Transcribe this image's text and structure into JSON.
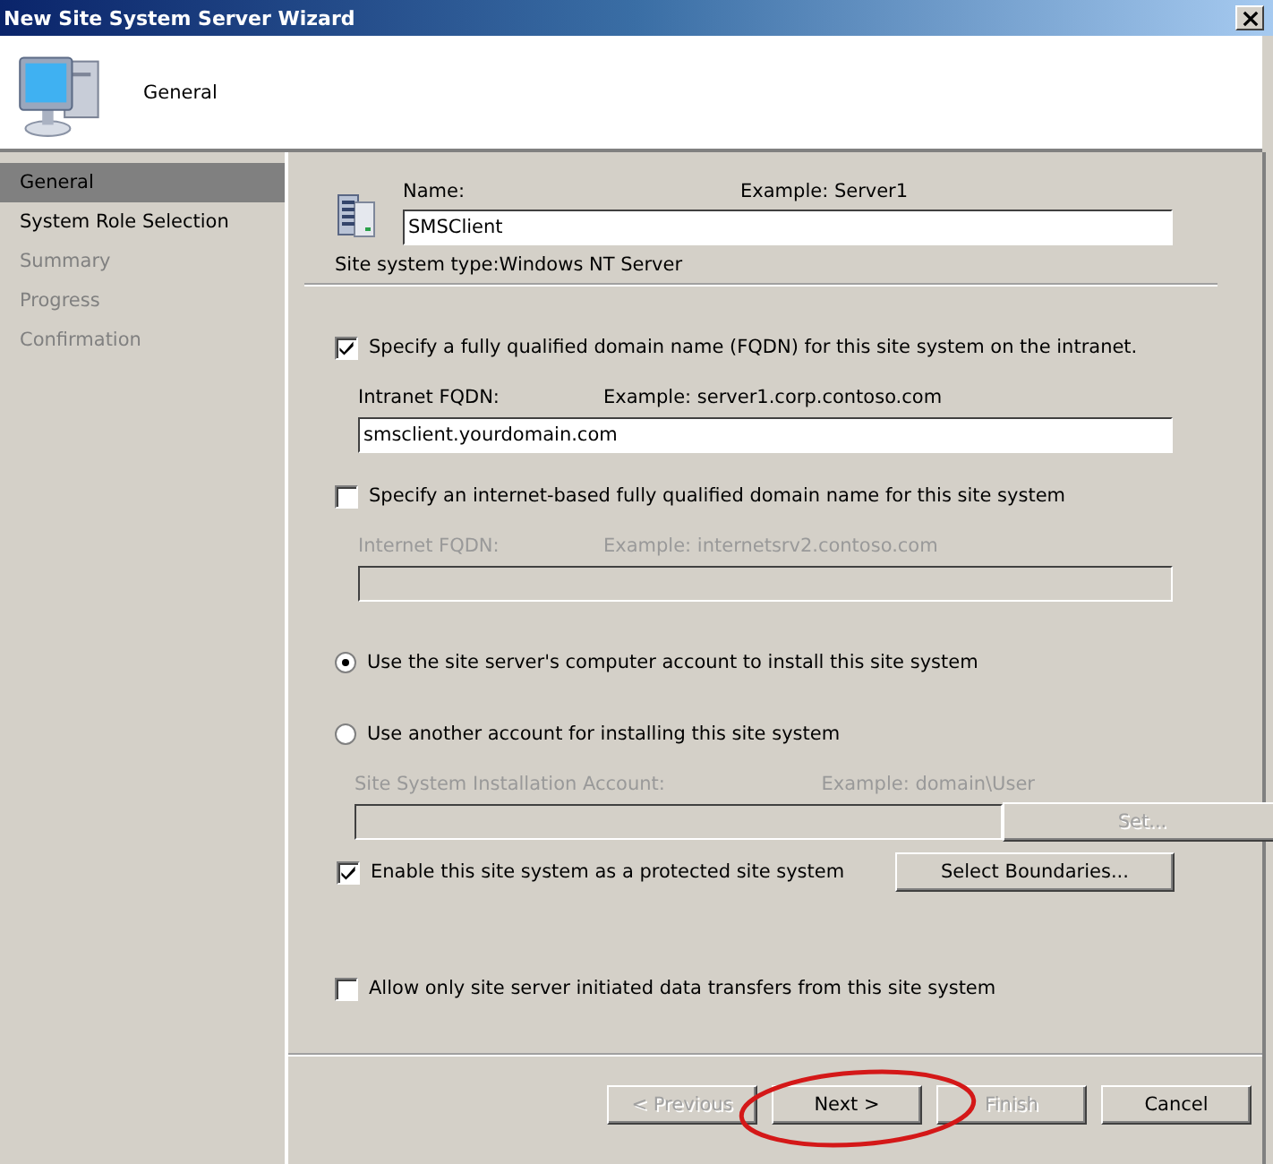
{
  "window": {
    "title": "New Site System Server Wizard"
  },
  "header": {
    "title": "General"
  },
  "sidebar": {
    "items": [
      {
        "label": "General",
        "selected": true,
        "disabled": false
      },
      {
        "label": "System Role Selection",
        "selected": false,
        "disabled": false
      },
      {
        "label": "Summary",
        "selected": false,
        "disabled": true
      },
      {
        "label": "Progress",
        "selected": false,
        "disabled": true
      },
      {
        "label": "Confirmation",
        "selected": false,
        "disabled": true
      }
    ]
  },
  "form": {
    "name": {
      "label": "Name:",
      "example": "Example: Server1",
      "value": "SMSClient"
    },
    "site_system_type": "Site system type:Windows NT Server",
    "fqdn_checkbox": {
      "label": "Specify a fully qualified domain name (FQDN) for this site system on the intranet.",
      "checked": true
    },
    "intranet_fqdn": {
      "label": "Intranet FQDN:",
      "example": "Example: server1.corp.contoso.com",
      "value": "smsclient.yourdomain.com",
      "disabled": false
    },
    "internet_checkbox": {
      "label": "Specify an internet-based fully qualified domain name for this site system",
      "checked": false
    },
    "internet_fqdn": {
      "label": "Internet FQDN:",
      "example": "Example: internetsrv2.contoso.com",
      "disabled": true
    },
    "account_radios": [
      {
        "label": "Use the site server's computer account to install this site system",
        "selected": true
      },
      {
        "label": "Use another account for installing this site system",
        "selected": false
      }
    ],
    "installation_account": {
      "label": "Site System Installation Account:",
      "example": "Example: domain\\User",
      "disabled": true
    },
    "set_button": {
      "label": "Set...",
      "disabled": true
    },
    "protected_checkbox": {
      "label": "Enable this site system as a protected site system",
      "checked": true
    },
    "boundaries_button": {
      "label": "Select Boundaries...",
      "disabled": false
    },
    "transfers_checkbox": {
      "label": "Allow only site server initiated data transfers from this site system",
      "checked": false
    }
  },
  "buttons": [
    {
      "label": "< Previous",
      "disabled": true
    },
    {
      "label": "Next >",
      "disabled": false
    },
    {
      "label": "Finish",
      "disabled": true
    },
    {
      "label": "Cancel",
      "disabled": false
    }
  ]
}
